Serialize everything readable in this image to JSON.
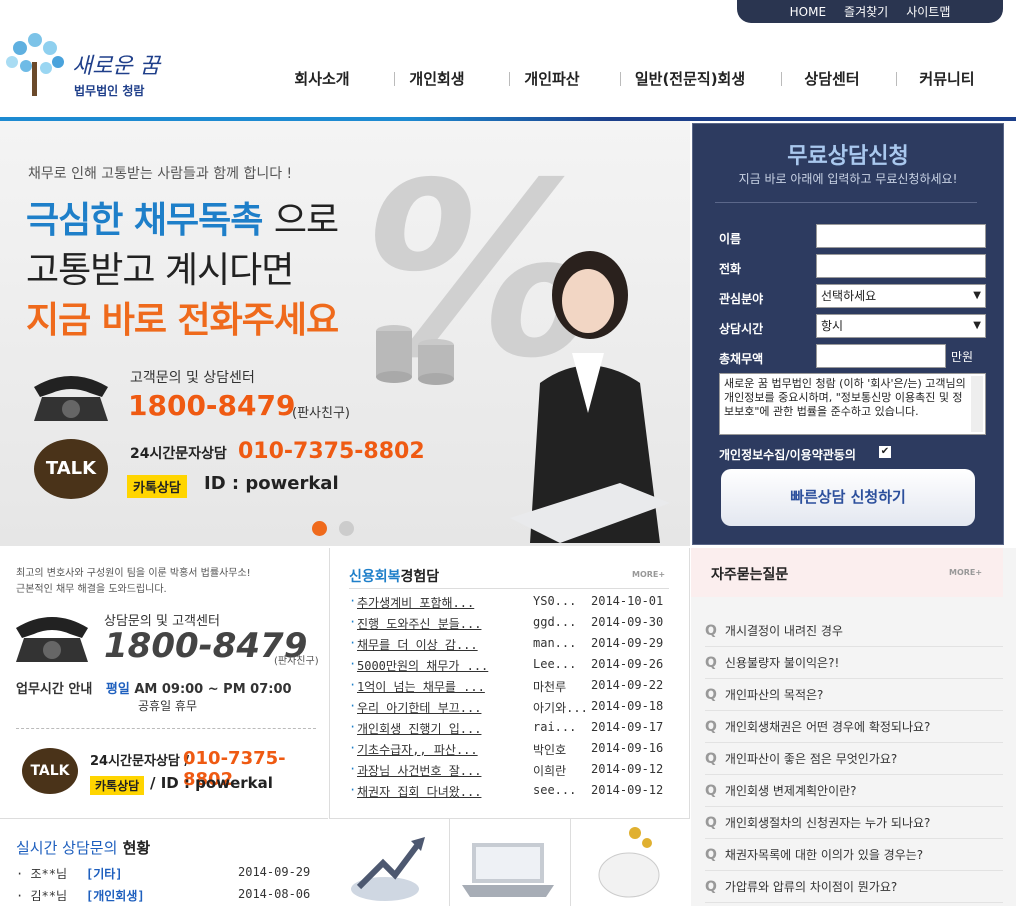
{
  "util": [
    "HOME",
    "즐겨찾기",
    "사이트맵"
  ],
  "logo": {
    "title": "새로운 꿈",
    "subtitle": "법무법인 청람"
  },
  "gnb": [
    "회사소개",
    "개인회생",
    "개인파산",
    "일반(전문직)회생",
    "상담센터",
    "커뮤니티"
  ],
  "hero": {
    "sub": "채무로 인해 고통받는 사람들과  함께 합니다 !",
    "line1_em": "극심한 채무독촉",
    "line1_rest": "으로",
    "line2": "고통받고 계시다면",
    "line3": "지금 바로 전화주세요",
    "cs_label": "고객문의 및 상담센터",
    "cs_number": "1800-8479",
    "cs_note": "(판사친구)",
    "sms_label": "24시간문자상담",
    "sms_number": "010-7375-8802",
    "kakao_badge": "카톡상담",
    "kakao_id": "ID : powerkal",
    "talk": "TALK",
    "percent": "%"
  },
  "form": {
    "title": "무료상담신청",
    "subtitle": "지금 바로 아래에 입력하고 무료신청하세요!",
    "name_label": "이름",
    "phone_label": "전화",
    "interest_label": "관심분야",
    "interest_value": "선택하세요",
    "time_label": "상담시간",
    "time_value": "항시",
    "debt_label": "총채무액",
    "debt_unit": "만원",
    "terms": "새로운 꿈 법무법인 청람 (이하 '회사'은/는) 고객님의 개인정보를 중요시하며, \"정보통신망 이용촉진 및 정보보호\"에 관한 법률을 준수하고 있습니다.",
    "agree": "개인정보수집/이용약관동의",
    "submit": "빠른상담 신청하기"
  },
  "left": {
    "intro1": "최고의 변호사와 구성원이 팀을 이룬 박홍서 법률사무소!",
    "intro2": "근본적인 채무 해결을 도와드립니다.",
    "label": "상담문의 및 고객센터",
    "number": "1800-8479",
    "note": "(판사친구)",
    "hours_label": "업무시간 안내",
    "hours_weekday": "평일",
    "hours": "AM 09:00 ~ PM 07:00",
    "holiday": "공휴일 휴무",
    "sms_label": "24시간문자상담 /",
    "sms_number": "010-7375-8802",
    "kakao_badge": "카톡상담",
    "kakao_id": "/ ID : powerkal",
    "talk": "TALK"
  },
  "realtime": {
    "title_em": "실시간 상담문의",
    "title_rest": " 현황",
    "rows": [
      {
        "name": "· 조**님",
        "cat": "[기타]",
        "date": "2014-09-29"
      },
      {
        "name": "· 김**님",
        "cat": "[개인회생]",
        "date": "2014-08-06"
      }
    ]
  },
  "reviews": {
    "title_em": "신용회복",
    "title_rest": "경험담",
    "more": "MORE+",
    "rows": [
      {
        "title": "추가생계비 포함해...",
        "author": "YS0...",
        "date": "2014-10-01"
      },
      {
        "title": "진행 도와주신 분들...",
        "author": "ggd...",
        "date": "2014-09-30"
      },
      {
        "title": "채무를 더 이상 감...",
        "author": "man...",
        "date": "2014-09-29"
      },
      {
        "title": "5000만원의 채무가 ...",
        "author": "Lee...",
        "date": "2014-09-26"
      },
      {
        "title": "1억이 넘는 채무를 ...",
        "author": "마천루",
        "date": "2014-09-22"
      },
      {
        "title": "우리 아기한테 부끄...",
        "author": "아기와...",
        "date": "2014-09-18"
      },
      {
        "title": "개인회생 진행기 입...",
        "author": "rai...",
        "date": "2014-09-17"
      },
      {
        "title": "기초수급자,, 파산...",
        "author": "박인호",
        "date": "2014-09-16"
      },
      {
        "title": "과장님 사건번호 잘...",
        "author": "이희란",
        "date": "2014-09-12"
      },
      {
        "title": "채권자 집회 다녀왔...",
        "author": "see...",
        "date": "2014-09-12"
      }
    ]
  },
  "faq": {
    "title": "자주묻는질문",
    "more": "MORE+",
    "rows": [
      "개시결정이 내려진 경우",
      "신용불량자 불이익은?!",
      "개인파산의 목적은?",
      "개인회생채권은 어떤 경우에 확정되나요?",
      "개인파산이 좋은 점은 무엇인가요?",
      "개인회생 변제계획안이란?",
      "개인회생절차의 신청권자는 누가 되나요?",
      "채권자목록에 대한 이의가 있을 경우는?",
      "가압류와 압류의 차이점이 뭔가요?"
    ]
  },
  "colors": {
    "accent": "#1e7fc9",
    "orange": "#ef5a12",
    "navy": "#2d3b60"
  }
}
